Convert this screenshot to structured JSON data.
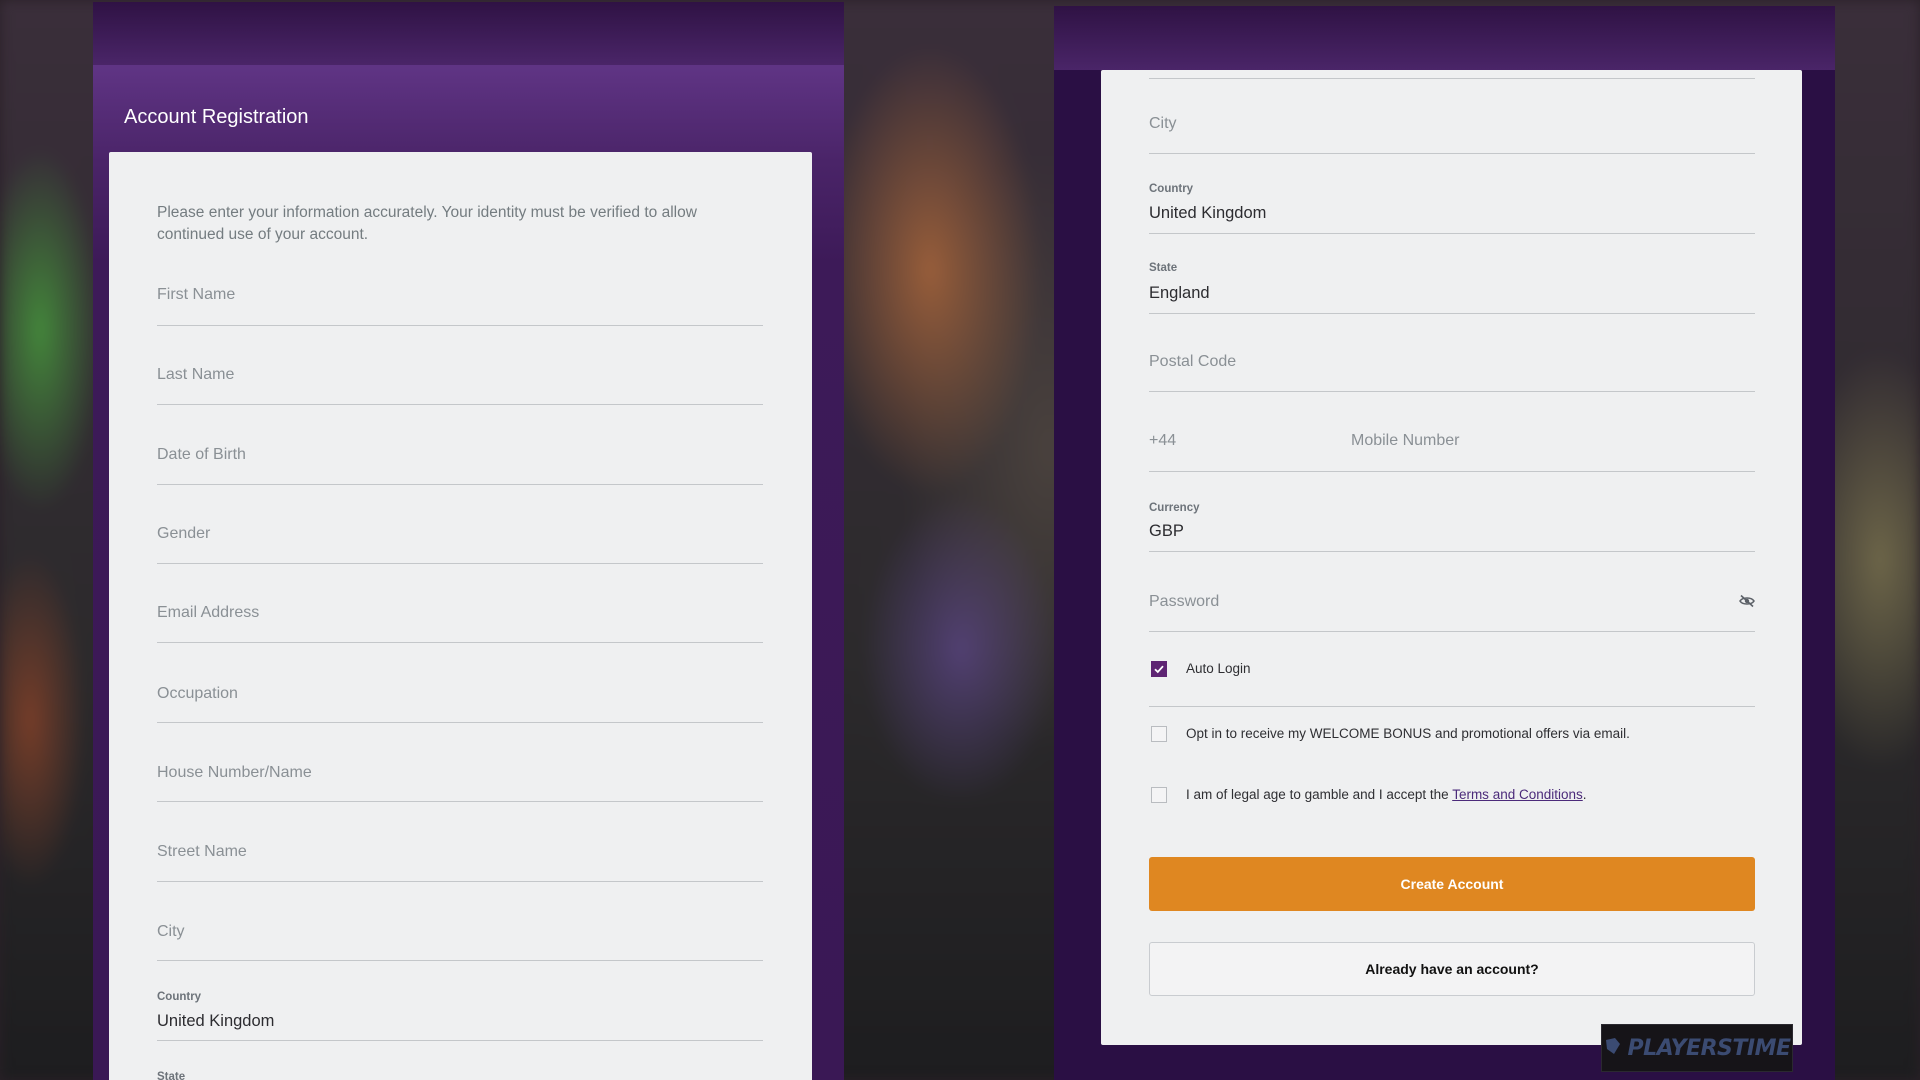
{
  "left_panel": {
    "title": "Account Registration",
    "intro": "Please enter your information accurately. Your identity must be verified to allow continued use of your account.",
    "fields": [
      {
        "label": "First Name"
      },
      {
        "label": "Last Name"
      },
      {
        "label": "Date of Birth"
      },
      {
        "label": "Gender"
      },
      {
        "label": "Email Address"
      },
      {
        "label": "Occupation"
      },
      {
        "label": "House Number/Name"
      },
      {
        "label": "Street Name"
      },
      {
        "label": "City"
      }
    ],
    "country": {
      "label": "Country",
      "value": "United Kingdom"
    },
    "state": {
      "label": "State"
    }
  },
  "right_panel": {
    "city": {
      "label": "City"
    },
    "country": {
      "label": "Country",
      "value": "United Kingdom"
    },
    "state": {
      "label": "State",
      "value": "England"
    },
    "postal_code": {
      "label": "Postal Code"
    },
    "phone": {
      "code": "+44",
      "placeholder": "Mobile Number"
    },
    "currency": {
      "label": "Currency",
      "value": "GBP"
    },
    "password": {
      "placeholder": "Password",
      "toggle_icon": "eye-off-icon"
    },
    "auto_login": {
      "label": "Auto Login",
      "checked": true
    },
    "opt_in": {
      "label": "Opt in to receive my WELCOME BONUS and promotional offers via email.",
      "checked": false
    },
    "terms": {
      "prefix": "I am of legal age to gamble and I accept the ",
      "link": "Terms and Conditions",
      "suffix": ".",
      "checked": false
    },
    "create_button": "Create Account",
    "login_button": "Already have an account?"
  },
  "watermark": {
    "text": "PLAYERSTIME"
  },
  "colors": {
    "purple_header": "#5f3484",
    "accent_orange": "#df8721",
    "checkbox_purple": "#5e2473",
    "card_bg": "#eff0f1"
  }
}
